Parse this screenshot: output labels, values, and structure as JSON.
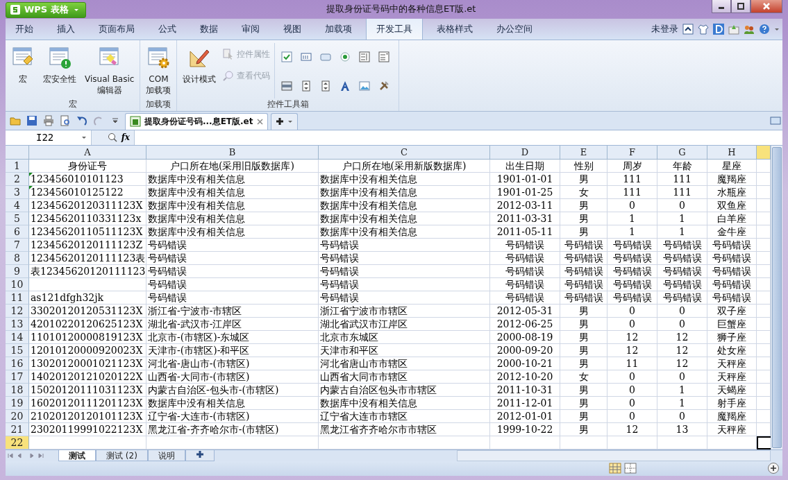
{
  "title_bar": {
    "app_button": "WPS 表格",
    "title": "提取身份证号码中的各种信息ET版.et"
  },
  "menu_tabs": [
    {
      "label": "开始",
      "selected": false
    },
    {
      "label": "插入",
      "selected": false
    },
    {
      "label": "页面布局",
      "selected": false
    },
    {
      "label": "公式",
      "selected": false
    },
    {
      "label": "数据",
      "selected": false
    },
    {
      "label": "审阅",
      "selected": false
    },
    {
      "label": "视图",
      "selected": false
    },
    {
      "label": "加载项",
      "selected": false
    },
    {
      "label": "开发工具",
      "selected": true
    },
    {
      "label": "表格样式",
      "selected": false
    },
    {
      "label": "办公空间",
      "selected": false
    }
  ],
  "account": "未登录",
  "ribbon": {
    "groups": [
      {
        "label": "宏",
        "buttons": [
          {
            "label": "宏",
            "kind": "macro"
          },
          {
            "label": "宏安全性",
            "kind": "security"
          },
          {
            "label": "Visual Basic\n编辑器",
            "kind": "editor"
          }
        ]
      },
      {
        "label": "加载项",
        "buttons": [
          {
            "label": "COM\n加载项",
            "kind": "com"
          }
        ]
      },
      {
        "label": "控件工具箱",
        "buttons": [
          {
            "label": "设计模式",
            "kind": "design"
          }
        ],
        "small_buttons": [
          {
            "label": "控件属性",
            "kind": "properties",
            "disabled": true
          },
          {
            "label": "查看代码",
            "kind": "code",
            "disabled": true
          }
        ],
        "tools": [
          {
            "kind": "checkbox"
          },
          {
            "kind": "textbox"
          },
          {
            "kind": "button"
          },
          {
            "kind": "radio"
          },
          {
            "kind": "listbox"
          },
          {
            "kind": "combobox"
          },
          {
            "kind": "scrollbar"
          },
          {
            "kind": "spinner"
          },
          {
            "kind": "spinner"
          },
          {
            "kind": "label"
          },
          {
            "kind": "image"
          },
          {
            "kind": "more"
          }
        ]
      }
    ]
  },
  "doc_tabs": [
    {
      "label": "提取身份证号码...息ET版.et",
      "selected": true
    }
  ],
  "formula_bar": {
    "name_box": "I22",
    "fx_label": "fx"
  },
  "columns": [
    {
      "label": "A",
      "selected": false
    },
    {
      "label": "B",
      "selected": false
    },
    {
      "label": "C",
      "selected": false
    },
    {
      "label": "D",
      "selected": false
    },
    {
      "label": "E",
      "selected": false
    },
    {
      "label": "F",
      "selected": false
    },
    {
      "label": "G",
      "selected": false
    },
    {
      "label": "H",
      "selected": false
    }
  ],
  "cut_column": {
    "selected": true
  },
  "rows": [
    {
      "number": "1",
      "kind": "header",
      "selected": false,
      "flagged": false,
      "cells": [
        "身份证号",
        "户口所在地(采用旧版数据库)",
        "户口所在地(采用新版数据库)",
        "出生日期",
        "性别",
        "周岁",
        "年龄",
        "星座"
      ]
    },
    {
      "number": "2",
      "kind": "data",
      "selected": false,
      "flagged": true,
      "cells": [
        "123456010101123",
        "数据库中没有相关信息",
        "数据库中没有相关信息",
        "1901-01-01",
        "男",
        "111",
        "111",
        "魔羯座"
      ]
    },
    {
      "number": "3",
      "kind": "data",
      "selected": false,
      "flagged": true,
      "cells": [
        "123456010125122",
        "数据库中没有相关信息",
        "数据库中没有相关信息",
        "1901-01-25",
        "女",
        "111",
        "111",
        "水瓶座"
      ]
    },
    {
      "number": "4",
      "kind": "data",
      "selected": false,
      "flagged": false,
      "cells": [
        "12345620120311123X",
        "数据库中没有相关信息",
        "数据库中没有相关信息",
        "2012-03-11",
        "男",
        "0",
        "0",
        "双鱼座"
      ]
    },
    {
      "number": "5",
      "kind": "data",
      "selected": false,
      "flagged": false,
      "cells": [
        "12345620110331123x",
        "数据库中没有相关信息",
        "数据库中没有相关信息",
        "2011-03-31",
        "男",
        "1",
        "1",
        "白羊座"
      ]
    },
    {
      "number": "6",
      "kind": "data",
      "selected": false,
      "flagged": false,
      "cells": [
        "12345620110511123X",
        "数据库中没有相关信息",
        "数据库中没有相关信息",
        "2011-05-11",
        "男",
        "1",
        "1",
        "金牛座"
      ]
    },
    {
      "number": "7",
      "kind": "data",
      "selected": false,
      "flagged": false,
      "cells": [
        "12345620120111123Z",
        "号码错误",
        "号码错误",
        "号码错误",
        "号码错误",
        "号码错误",
        "号码错误",
        "号码错误"
      ]
    },
    {
      "number": "8",
      "kind": "data",
      "selected": false,
      "flagged": false,
      "cells": [
        "12345620120111123表",
        "号码错误",
        "号码错误",
        "号码错误",
        "号码错误",
        "号码错误",
        "号码错误",
        "号码错误"
      ]
    },
    {
      "number": "9",
      "kind": "data",
      "selected": false,
      "flagged": false,
      "cells": [
        "表12345620120111123",
        "号码错误",
        "号码错误",
        "号码错误",
        "号码错误",
        "号码错误",
        "号码错误",
        "号码错误"
      ]
    },
    {
      "number": "10",
      "kind": "data",
      "selected": false,
      "flagged": false,
      "cells": [
        null,
        "号码错误",
        "号码错误",
        "号码错误",
        "号码错误",
        "号码错误",
        "号码错误",
        "号码错误"
      ]
    },
    {
      "number": "11",
      "kind": "data",
      "selected": false,
      "flagged": false,
      "cells": [
        "as121dfgh32jk",
        "号码错误",
        "号码错误",
        "号码错误",
        "号码错误",
        "号码错误",
        "号码错误",
        "号码错误"
      ]
    },
    {
      "number": "12",
      "kind": "data",
      "selected": false,
      "flagged": false,
      "cells": [
        "33020120120531123X",
        "浙江省-宁波市-市辖区",
        "浙江省宁波市市辖区",
        "2012-05-31",
        "男",
        "0",
        "0",
        "双子座"
      ]
    },
    {
      "number": "13",
      "kind": "data",
      "selected": false,
      "flagged": false,
      "cells": [
        "42010220120625123X",
        "湖北省-武汉市-江岸区",
        "湖北省武汉市江岸区",
        "2012-06-25",
        "男",
        "0",
        "0",
        "巨蟹座"
      ]
    },
    {
      "number": "14",
      "kind": "data",
      "selected": false,
      "flagged": false,
      "cells": [
        "11010120000819123X",
        "北京市-(市辖区)-东城区",
        "北京市东城区",
        "2000-08-19",
        "男",
        "12",
        "12",
        "狮子座"
      ]
    },
    {
      "number": "15",
      "kind": "data",
      "selected": false,
      "flagged": false,
      "cells": [
        "12010120000920023X",
        "天津市-(市辖区)-和平区",
        "天津市和平区",
        "2000-09-20",
        "男",
        "12",
        "12",
        "处女座"
      ]
    },
    {
      "number": "16",
      "kind": "data",
      "selected": false,
      "flagged": false,
      "cells": [
        "13020120001021123X",
        "河北省-唐山市-(市辖区)",
        "河北省唐山市市辖区",
        "2000-10-21",
        "男",
        "11",
        "12",
        "天秤座"
      ]
    },
    {
      "number": "17",
      "kind": "data",
      "selected": false,
      "flagged": false,
      "cells": [
        "14020120121020122X",
        "山西省-大同市-(市辖区)",
        "山西省大同市市辖区",
        "2012-10-20",
        "女",
        "0",
        "0",
        "天秤座"
      ]
    },
    {
      "number": "18",
      "kind": "data",
      "selected": false,
      "flagged": false,
      "cells": [
        "15020120111031123X",
        "内蒙古自治区-包头市-(市辖区)",
        "内蒙古自治区包头市市辖区",
        "2011-10-31",
        "男",
        "0",
        "1",
        "天蝎座"
      ]
    },
    {
      "number": "19",
      "kind": "data",
      "selected": false,
      "flagged": false,
      "cells": [
        "16020120111201123X",
        "数据库中没有相关信息",
        "数据库中没有相关信息",
        "2011-12-01",
        "男",
        "0",
        "1",
        "射手座"
      ]
    },
    {
      "number": "20",
      "kind": "data",
      "selected": false,
      "flagged": false,
      "cells": [
        "21020120120101123X",
        "辽宁省-大连市-(市辖区)",
        "辽宁省大连市市辖区",
        "2012-01-01",
        "男",
        "0",
        "0",
        "魔羯座"
      ]
    },
    {
      "number": "21",
      "kind": "data",
      "selected": false,
      "flagged": false,
      "cells": [
        "23020119991022123X",
        "黑龙江省-齐齐哈尔市-(市辖区)",
        "黑龙江省齐齐哈尔市市辖区",
        "1999-10-22",
        "男",
        "12",
        "13",
        "天秤座"
      ]
    },
    {
      "number": "22",
      "kind": "data",
      "selected": true,
      "flagged": false,
      "cells": []
    }
  ],
  "sheet_tabs": [
    {
      "label": "测试",
      "selected": true
    },
    {
      "label": "测试 (2)",
      "selected": false
    },
    {
      "label": "说明",
      "selected": false
    }
  ]
}
